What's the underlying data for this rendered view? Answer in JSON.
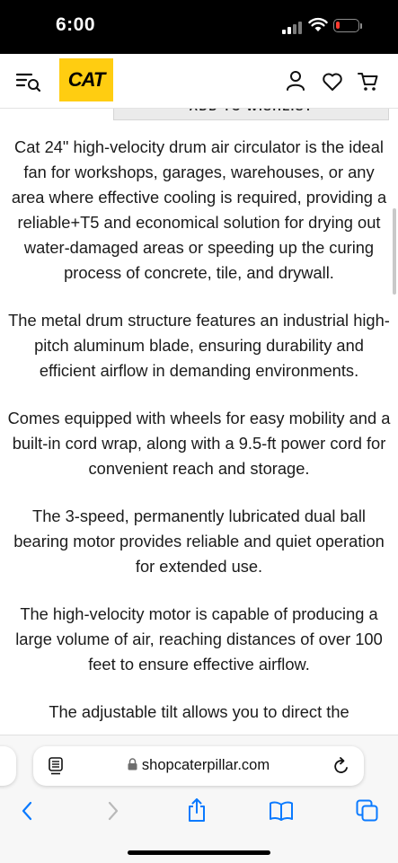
{
  "status_bar": {
    "time": "6:00"
  },
  "header": {
    "logo_text": "CAT"
  },
  "wishlist_button": {
    "label": "ADD TO WISHLIST"
  },
  "description": {
    "paragraphs": [
      "Cat 24\" high-velocity drum air circulator is the ideal fan for workshops, garages, warehouses, or any area where effective cooling is required, providing a reliable+T5 and economical solution for drying out water-damaged areas or speeding up the curing process of concrete, tile, and drywall.",
      "The metal drum structure features an industrial high-pitch aluminum blade, ensuring durability and efficient airflow in demanding environments.",
      "Comes equipped with wheels for easy mobility and a built-in cord wrap, along with a 9.5-ft power cord for convenient reach and storage.",
      "The 3-speed, permanently lubricated dual ball bearing motor provides reliable and quiet operation for extended use.",
      "The high-velocity motor is capable of producing a large volume of air, reaching distances of over 100 feet to ensure effective airflow.",
      "The adjustable tilt allows you to direct the"
    ]
  },
  "browser": {
    "url": "shopcaterpillar.com"
  },
  "icons": {
    "menu_search": "menu-search-icon",
    "account": "user-icon",
    "wishlist": "heart-icon",
    "cart": "cart-icon",
    "lock": "lock-icon",
    "reader": "reader-icon",
    "reload": "reload-icon",
    "back": "chevron-left-icon",
    "forward": "chevron-right-icon",
    "share": "share-icon",
    "bookmarks": "book-icon",
    "tabs": "tabs-icon"
  },
  "colors": {
    "brand_yellow": "#ffcd11",
    "safari_blue": "#0a7aff",
    "battery_red": "#ff3b30"
  }
}
